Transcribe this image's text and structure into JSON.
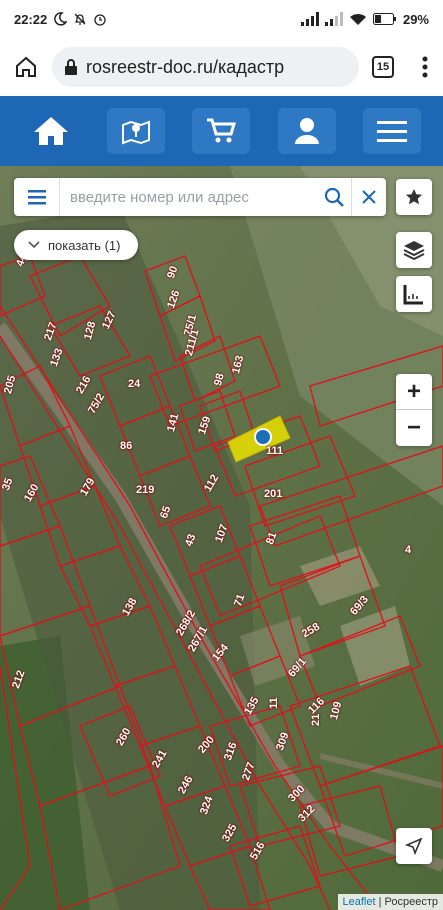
{
  "status_bar": {
    "time": "22:22",
    "battery": "29%"
  },
  "browser": {
    "url": "rosreestr-doc.ru/кадастр",
    "tab_count": "15"
  },
  "site_nav": {
    "icons": [
      "home-icon",
      "map-pin-icon",
      "cart-icon",
      "user-icon",
      "hamburger-icon"
    ]
  },
  "search": {
    "placeholder": "введите номер или адрес"
  },
  "show_button": {
    "label": "показать (1)"
  },
  "zoom": {
    "in_label": "+",
    "out_label": "−"
  },
  "attribution": {
    "leaflet": "Leaflet",
    "separator": " | ",
    "source": "Росреестр"
  },
  "parcels": [
    {
      "label": "44"
    },
    {
      "label": "90"
    },
    {
      "label": "126"
    },
    {
      "label": "127"
    },
    {
      "label": "217"
    },
    {
      "label": "128"
    },
    {
      "label": "133"
    },
    {
      "label": "75/1"
    },
    {
      "label": "211/1"
    },
    {
      "label": "24"
    },
    {
      "label": "163"
    },
    {
      "label": "98"
    },
    {
      "label": "205"
    },
    {
      "label": "216"
    },
    {
      "label": "75/2"
    },
    {
      "label": "141"
    },
    {
      "label": "159"
    },
    {
      "label": "86"
    },
    {
      "label": "111"
    },
    {
      "label": "35"
    },
    {
      "label": "160"
    },
    {
      "label": "179"
    },
    {
      "label": "219"
    },
    {
      "label": "112"
    },
    {
      "label": "201"
    },
    {
      "label": "65"
    },
    {
      "label": "43"
    },
    {
      "label": "107"
    },
    {
      "label": "81"
    },
    {
      "label": "4"
    },
    {
      "label": "138"
    },
    {
      "label": "71"
    },
    {
      "label": "69/3"
    },
    {
      "label": "268/2"
    },
    {
      "label": "258"
    },
    {
      "label": "267/1"
    },
    {
      "label": "154"
    },
    {
      "label": "69/1"
    },
    {
      "label": "212"
    },
    {
      "label": "135"
    },
    {
      "label": "11"
    },
    {
      "label": "116"
    },
    {
      "label": "260"
    },
    {
      "label": "200"
    },
    {
      "label": "21"
    },
    {
      "label": "109"
    },
    {
      "label": "241"
    },
    {
      "label": "316"
    },
    {
      "label": "309"
    },
    {
      "label": "246"
    },
    {
      "label": "277"
    },
    {
      "label": "300"
    },
    {
      "label": "324"
    },
    {
      "label": "312"
    },
    {
      "label": "325"
    },
    {
      "label": "516"
    }
  ]
}
